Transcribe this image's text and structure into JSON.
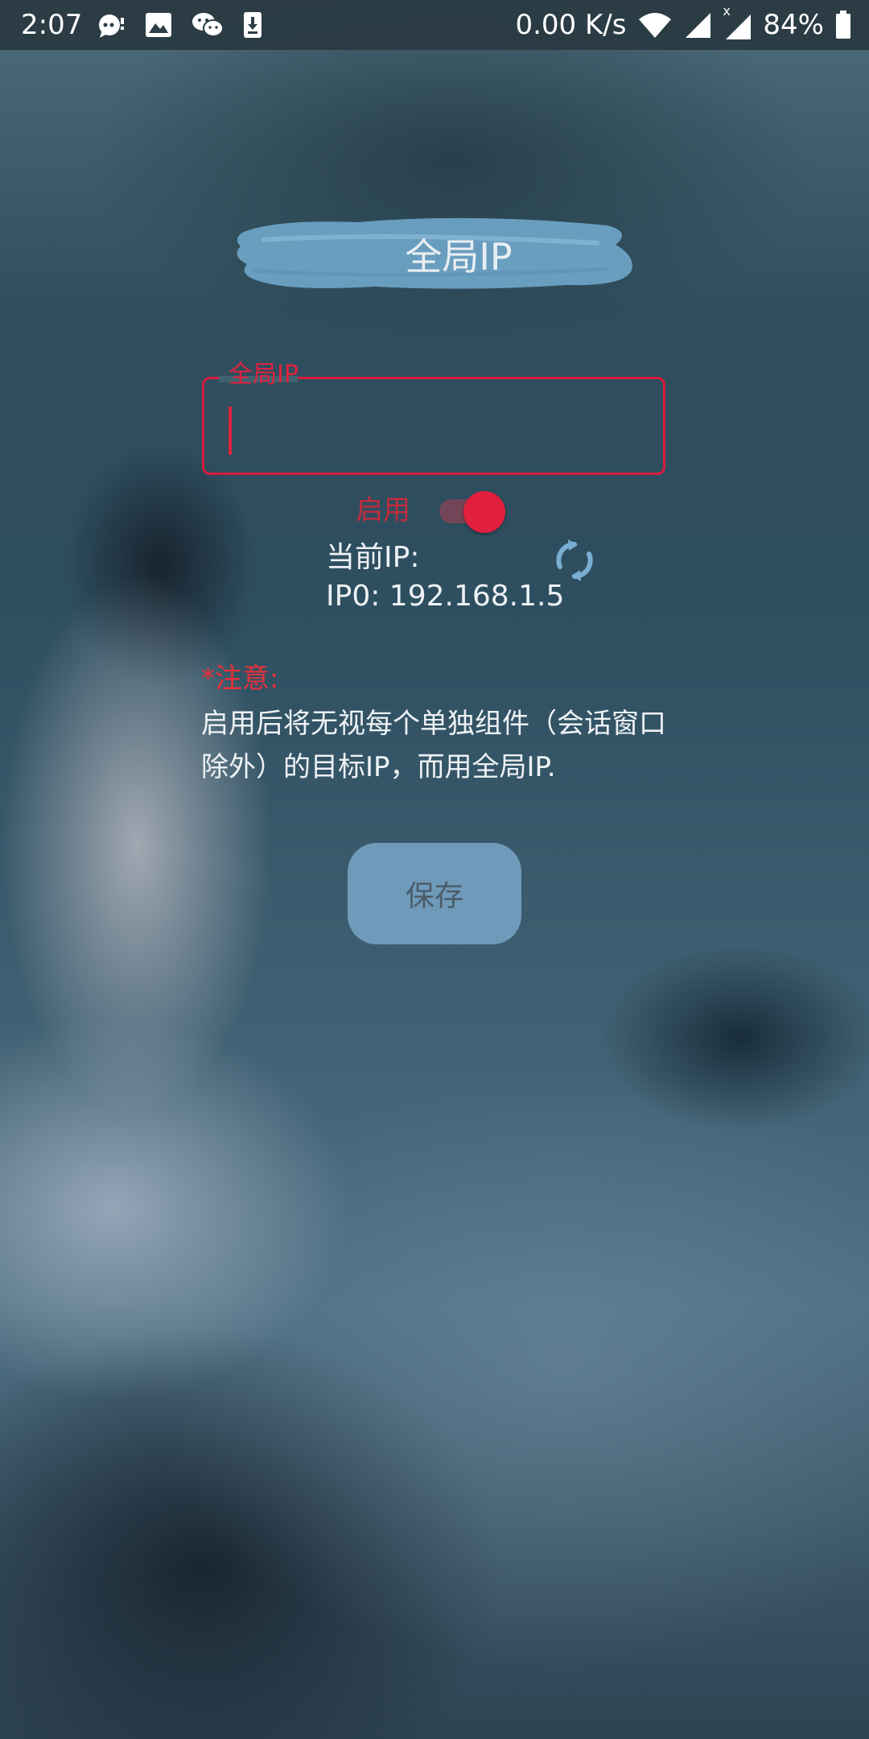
{
  "status_bar": {
    "time": "2:07",
    "network_speed": "0.00 K/s",
    "battery_percent": "84%",
    "signal_second_marker": "x",
    "left_icons": [
      "notification-chat-icon",
      "image-icon",
      "wechat-icon",
      "download-icon"
    ],
    "right_icons": [
      "wifi-icon",
      "signal-icon",
      "signal-icon",
      "battery-icon"
    ]
  },
  "header": {
    "title": "全局IP"
  },
  "ip_field": {
    "label": "全局IP",
    "value": "",
    "accent_color": "#d81b3c"
  },
  "enable_toggle": {
    "label": "启用",
    "checked": true
  },
  "current_ip": {
    "label": "当前IP:",
    "value": "IP0: 192.168.1.5"
  },
  "notice": {
    "title": "*注意:",
    "body": "启用后将无视每个单独组件（会话窗口除外）的目标IP，而用全局IP."
  },
  "actions": {
    "save_label": "保存"
  }
}
